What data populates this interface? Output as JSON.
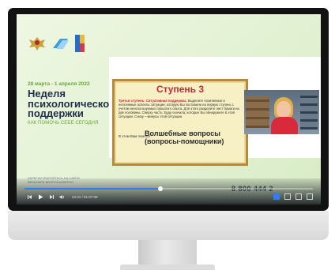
{
  "event": {
    "dates": "28 марта - 1 апреля 2022",
    "title_lines": [
      "Неделя",
      "психологической",
      "поддержки"
    ],
    "subtitle": "КАК ПОМОЧЬ СЕБЕ СЕГОДНЯ"
  },
  "slide": {
    "heading": "Ступень 3",
    "step_label": "Третья ступень:",
    "step_name": "Ситуативная поддержка.",
    "body": "Выделите позитивные и негативные аспекты ситуации, которую Вы поставили на первую ступень с учетом неиспользуемых прошлого опыта. Для этого разделите лист бумаги на две половины. Сверху часть: Буду сначала, которые Вы обнаружите в этой ситуации. Снизу – минусы этой ситуации.",
    "line2": "В этом Вам помогут:",
    "magic": "Волшебные вопросы (вопросы-помощники)"
  },
  "player": {
    "register_text": "ЗАРЕГИСТРИРУЙТЕСЬ НА САЙТЕ ВЕБИНАРА ВОПРОСЫ/ВЕРНО",
    "timecode": "24:41 / 01:07:08",
    "phone": "8 800 444 2",
    "progress": 0.47
  },
  "icons": {
    "play": "play-icon",
    "skip_back": "skip-back-icon",
    "skip_forward": "skip-forward-icon",
    "volume": "volume-icon",
    "settings": "settings-icon",
    "fullscreen": "fullscreen-icon"
  },
  "colors": {
    "accent_green": "#6aa63a",
    "title_navy": "#1f2f4a",
    "slide_red": "#c6283b",
    "progress_blue": "#2f7cf6"
  }
}
